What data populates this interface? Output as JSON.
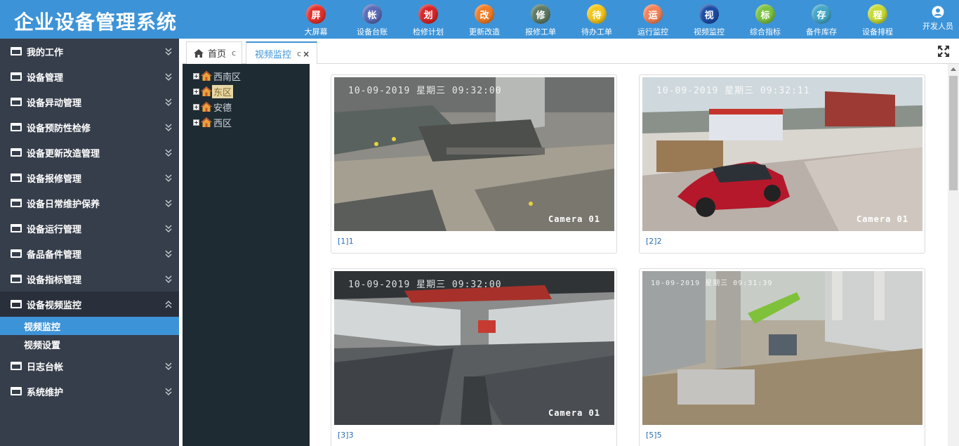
{
  "header": {
    "app_title": "企业设备管理系统",
    "bg_color": "#3d93d7",
    "nav": [
      {
        "glyph": "屏",
        "label": "大屏幕",
        "color": "#e5322d",
        "icon": "screen-icon"
      },
      {
        "glyph": "帐",
        "label": "设备台账",
        "color": "#5b6bb6",
        "icon": "ledger-icon"
      },
      {
        "glyph": "划",
        "label": "检修计划",
        "color": "#d8272a",
        "icon": "plan-icon"
      },
      {
        "glyph": "改",
        "label": "更新改造",
        "color": "#f07d26",
        "icon": "renovate-icon"
      },
      {
        "glyph": "修",
        "label": "报修工单",
        "color": "#5f7a64",
        "icon": "repair-icon"
      },
      {
        "glyph": "待",
        "label": "待办工单",
        "color": "#f4c61b",
        "icon": "todo-icon"
      },
      {
        "glyph": "运",
        "label": "运行监控",
        "color": "#f2825a",
        "icon": "run-icon"
      },
      {
        "glyph": "视",
        "label": "视频监控",
        "color": "#1d4ca6",
        "icon": "video-icon"
      },
      {
        "glyph": "标",
        "label": "综合指标",
        "color": "#7cc242",
        "icon": "index-icon"
      },
      {
        "glyph": "存",
        "label": "备件库存",
        "color": "#45a6c8",
        "icon": "stock-icon"
      },
      {
        "glyph": "程",
        "label": "设备排程",
        "color": "#c6da38",
        "icon": "schedule-icon"
      }
    ],
    "user_label": "开发人员"
  },
  "sidebar": {
    "items": [
      {
        "label": "我的工作",
        "expanded": false
      },
      {
        "label": "设备管理",
        "expanded": false
      },
      {
        "label": "设备异动管理",
        "expanded": false
      },
      {
        "label": "设备预防性检修",
        "expanded": false
      },
      {
        "label": "设备更新改造管理",
        "expanded": false
      },
      {
        "label": "设备报修管理",
        "expanded": false
      },
      {
        "label": "设备日常维护保养",
        "expanded": false
      },
      {
        "label": "设备运行管理",
        "expanded": false
      },
      {
        "label": "备品备件管理",
        "expanded": false
      },
      {
        "label": "设备指标管理",
        "expanded": false
      },
      {
        "label": "设备视频监控",
        "expanded": true
      },
      {
        "label": "日志台帐",
        "expanded": false
      },
      {
        "label": "系统维护",
        "expanded": false
      }
    ],
    "subitems": [
      {
        "label": "视频监控",
        "active": true
      },
      {
        "label": "视频设置",
        "active": false
      }
    ]
  },
  "tabs": {
    "home": {
      "label": "首页",
      "refresh": "c"
    },
    "video": {
      "label": "视频监控",
      "refresh": "c",
      "close": "×"
    }
  },
  "tree": {
    "nodes": [
      {
        "label": "西南区",
        "selected": false
      },
      {
        "label": "东区",
        "selected": true
      },
      {
        "label": "安德",
        "selected": false
      },
      {
        "label": "西区",
        "selected": false
      }
    ]
  },
  "cameras": [
    {
      "timestamp": "10-09-2019 星期三 09:32:00",
      "name": "Camera 01",
      "caption": "[1]1"
    },
    {
      "timestamp": "10-09-2019 星期三 09:32:11",
      "name": "Camera 01",
      "caption": "[2]2"
    },
    {
      "timestamp": "10-09-2019 星期三 09:32:00",
      "name": "Camera 01",
      "caption": "[3]3"
    },
    {
      "timestamp": "10-09-2019 星期三 09:31:39",
      "name": "",
      "caption": "[5]5"
    }
  ]
}
